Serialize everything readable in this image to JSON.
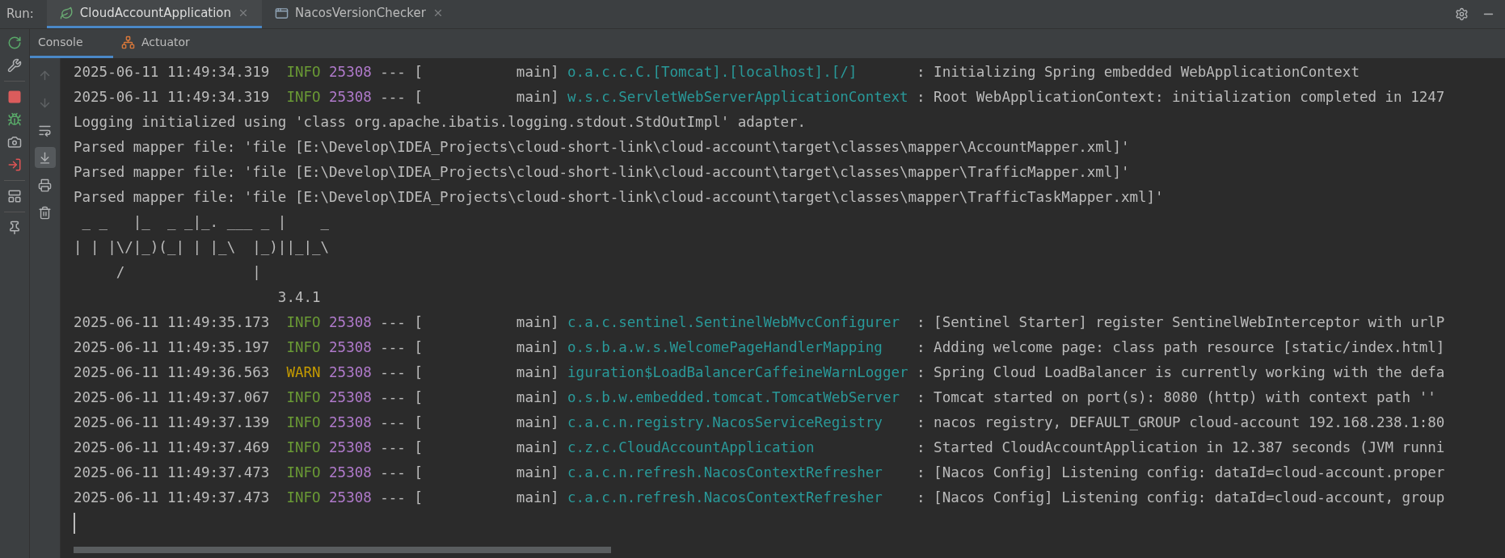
{
  "run_label": "Run:",
  "run_tabs": [
    {
      "label": "CloudAccountApplication",
      "kind": "spring",
      "selected": true
    },
    {
      "label": "NacosVersionChecker",
      "kind": "window",
      "selected": false
    }
  ],
  "side_tools": [
    {
      "kind": "rerun"
    },
    {
      "kind": "wrench"
    },
    {
      "kind": "separator"
    },
    {
      "kind": "stop"
    },
    {
      "kind": "debug"
    },
    {
      "kind": "camera"
    },
    {
      "kind": "exit"
    },
    {
      "kind": "separator"
    },
    {
      "kind": "layout"
    },
    {
      "kind": "separator"
    },
    {
      "kind": "pin"
    }
  ],
  "console_tabs": [
    {
      "label": "Console",
      "kind": "console",
      "selected": true
    },
    {
      "label": "Actuator",
      "kind": "actuator",
      "selected": false
    }
  ],
  "console_tools": [
    {
      "kind": "up",
      "disabled": true,
      "on": false
    },
    {
      "kind": "down",
      "disabled": true,
      "on": false
    },
    {
      "kind": "wrap",
      "disabled": false,
      "on": false
    },
    {
      "kind": "scroll-end",
      "disabled": false,
      "on": true
    },
    {
      "kind": "print",
      "disabled": false,
      "on": false
    },
    {
      "kind": "trash",
      "disabled": false,
      "on": false
    }
  ],
  "lines": [
    {
      "kind": "log",
      "time": "2025-06-11 11:49:34.319",
      "level": "INFO",
      "pid": "25308",
      "thread": "--- [           main]",
      "logger": "o.a.c.c.C.[Tomcat].[localhost].[/]",
      "message": ": Initializing Spring embedded WebApplicationContext"
    },
    {
      "kind": "log",
      "time": "2025-06-11 11:49:34.319",
      "level": "INFO",
      "pid": "25308",
      "thread": "--- [           main]",
      "logger": "w.s.c.ServletWebServerApplicationContext",
      "message": ": Root WebApplicationContext: initialization completed in 1247"
    },
    {
      "kind": "plain",
      "text": "Logging initialized using 'class org.apache.ibatis.logging.stdout.StdOutImpl' adapter."
    },
    {
      "kind": "plain",
      "text": "Parsed mapper file: 'file [E:\\Develop\\IDEA_Projects\\cloud-short-link\\cloud-account\\target\\classes\\mapper\\AccountMapper.xml]'"
    },
    {
      "kind": "plain",
      "text": "Parsed mapper file: 'file [E:\\Develop\\IDEA_Projects\\cloud-short-link\\cloud-account\\target\\classes\\mapper\\TrafficMapper.xml]'"
    },
    {
      "kind": "plain",
      "text": "Parsed mapper file: 'file [E:\\Develop\\IDEA_Projects\\cloud-short-link\\cloud-account\\target\\classes\\mapper\\TrafficTaskMapper.xml]'"
    },
    {
      "kind": "plain",
      "text": " _ _   |_  _ _|_. ___ _ |    _ "
    },
    {
      "kind": "plain",
      "text": "| | |\\/|_)(_| | |_\\  |_)||_|_\\ "
    },
    {
      "kind": "plain",
      "text": "     /               |"
    },
    {
      "kind": "plain",
      "text": "                        3.4.1"
    },
    {
      "kind": "log",
      "time": "2025-06-11 11:49:35.173",
      "level": "INFO",
      "pid": "25308",
      "thread": "--- [           main]",
      "logger": "c.a.c.sentinel.SentinelWebMvcConfigurer",
      "message": ": [Sentinel Starter] register SentinelWebInterceptor with urlP"
    },
    {
      "kind": "log",
      "time": "2025-06-11 11:49:35.197",
      "level": "INFO",
      "pid": "25308",
      "thread": "--- [           main]",
      "logger": "o.s.b.a.w.s.WelcomePageHandlerMapping",
      "message": ": Adding welcome page: class path resource [static/index.html]"
    },
    {
      "kind": "log",
      "time": "2025-06-11 11:49:36.563",
      "level": "WARN",
      "pid": "25308",
      "thread": "--- [           main]",
      "logger": "iguration$LoadBalancerCaffeineWarnLogger",
      "message": ": Spring Cloud LoadBalancer is currently working with the defa"
    },
    {
      "kind": "log",
      "time": "2025-06-11 11:49:37.067",
      "level": "INFO",
      "pid": "25308",
      "thread": "--- [           main]",
      "logger": "o.s.b.w.embedded.tomcat.TomcatWebServer",
      "message": ": Tomcat started on port(s): 8080 (http) with context path ''"
    },
    {
      "kind": "log",
      "time": "2025-06-11 11:49:37.139",
      "level": "INFO",
      "pid": "25308",
      "thread": "--- [           main]",
      "logger": "c.a.c.n.registry.NacosServiceRegistry",
      "message": ": nacos registry, DEFAULT_GROUP cloud-account 192.168.238.1:80"
    },
    {
      "kind": "log",
      "time": "2025-06-11 11:49:37.469",
      "level": "INFO",
      "pid": "25308",
      "thread": "--- [           main]",
      "logger": "c.z.c.CloudAccountApplication",
      "message": ": Started CloudAccountApplication in 12.387 seconds (JVM runni"
    },
    {
      "kind": "log",
      "time": "2025-06-11 11:49:37.473",
      "level": "INFO",
      "pid": "25308",
      "thread": "--- [           main]",
      "logger": "c.a.c.n.refresh.NacosContextRefresher",
      "message": ": [Nacos Config] Listening config: dataId=cloud-account.proper"
    },
    {
      "kind": "log",
      "time": "2025-06-11 11:49:37.473",
      "level": "INFO",
      "pid": "25308",
      "thread": "--- [           main]",
      "logger": "c.a.c.n.refresh.NacosContextRefresher",
      "message": ": [Nacos Config] Listening config: dataId=cloud-account, group"
    }
  ]
}
